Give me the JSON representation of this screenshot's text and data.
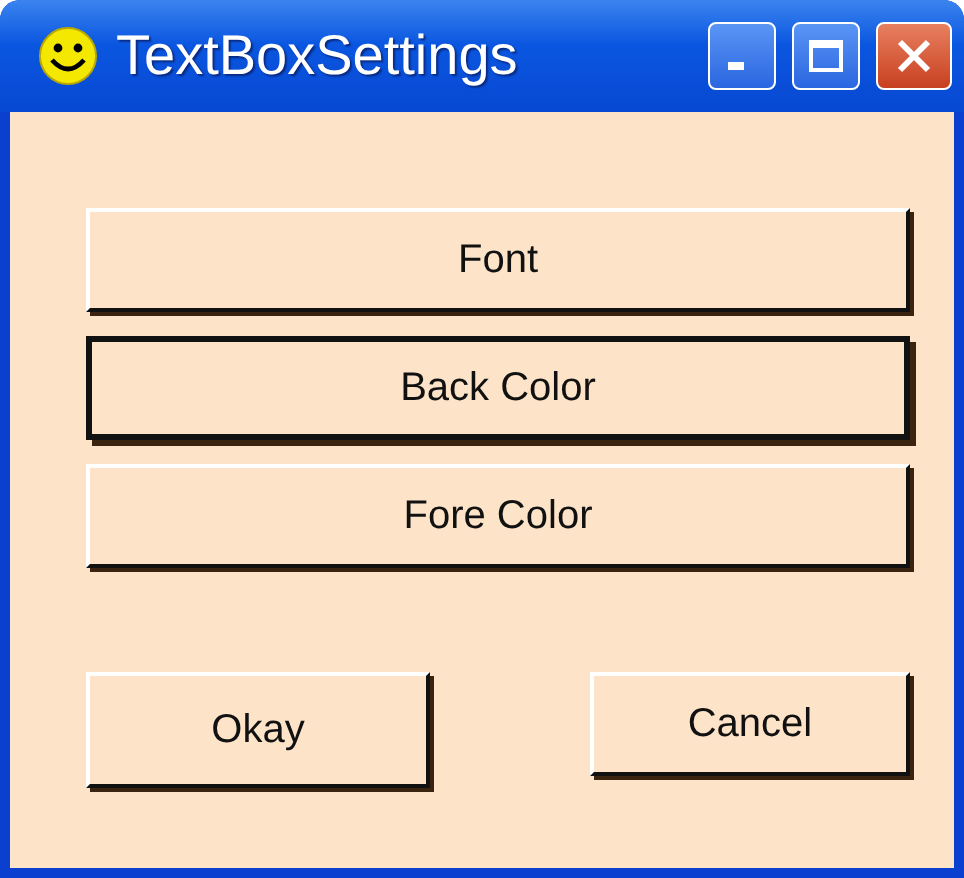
{
  "window": {
    "title": "TextBoxSettings"
  },
  "buttons": [
    {
      "label": "Font",
      "focused": false
    },
    {
      "label": "Back Color",
      "focused": true
    },
    {
      "label": "Fore Color",
      "focused": false
    }
  ],
  "dialog_buttons": [
    {
      "label": "Okay",
      "focused": false
    },
    {
      "label": "Cancel",
      "focused": false
    }
  ]
}
